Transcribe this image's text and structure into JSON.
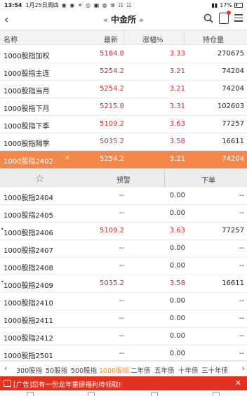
{
  "status_bar": {
    "time": "13:54",
    "date": "1月25日周四",
    "battery": "17%"
  },
  "nav": {
    "title": "中金所"
  },
  "columns": {
    "name": "名称",
    "price": "最新",
    "change_pct": "涨幅%",
    "open_interest": "持仓量"
  },
  "rows": [
    {
      "name": "1000股指加权",
      "price": "5184.8",
      "pct": "3.33",
      "oi": "270675"
    },
    {
      "name": "1000股指主连",
      "price": "5254.2",
      "pct": "3.21",
      "oi": "74204"
    },
    {
      "name": "1000股指当月",
      "price": "5254.2",
      "pct": "3.21",
      "oi": "74204"
    },
    {
      "name": "1000股指下月",
      "price": "5215.8",
      "pct": "3.31",
      "oi": "102603"
    },
    {
      "name": "1000股指下季",
      "price": "5109.2",
      "pct": "3.63",
      "oi": "77257"
    },
    {
      "name": "1000股指隔季",
      "price": "5035.2",
      "pct": "3.58",
      "oi": "16611"
    },
    {
      "name": "1000股指2402",
      "price": "5254.2",
      "pct": "3.21",
      "oi": "74204",
      "close": "×"
    }
  ],
  "actions": {
    "trade": "预警",
    "order": "下单"
  },
  "contract_rows": [
    {
      "name": "1000股指2404",
      "price": "--",
      "pct": "0.00",
      "oi": "--",
      "flag": ""
    },
    {
      "name": "1000股指2405",
      "price": "--",
      "pct": "0.00",
      "oi": "--",
      "flag": ""
    },
    {
      "name": "1000股指2406",
      "price": "5109.2",
      "pct": "3.63",
      "oi": "77257",
      "flag": "•"
    },
    {
      "name": "1000股指2407",
      "price": "--",
      "pct": "0.00",
      "oi": "--",
      "flag": ""
    },
    {
      "name": "1000股指2408",
      "price": "--",
      "pct": "0.00",
      "oi": "--",
      "flag": ""
    },
    {
      "name": "1000股指2409",
      "price": "5035.2",
      "pct": "3.58",
      "oi": "16611",
      "flag": "•"
    },
    {
      "name": "1000股指2410",
      "price": "--",
      "pct": "0.00",
      "oi": "--",
      "flag": ""
    },
    {
      "name": "1000股指2411",
      "price": "--",
      "pct": "0.00",
      "oi": "--",
      "flag": ""
    },
    {
      "name": "1000股指2412",
      "price": "--",
      "pct": "0.00",
      "oi": "--",
      "flag": ""
    },
    {
      "name": "1000股指2501",
      "price": "--",
      "pct": "0.00",
      "oi": "--",
      "flag": ""
    }
  ],
  "tabs": [
    {
      "label": "300股指"
    },
    {
      "label": "50股指"
    },
    {
      "label": "500股指"
    },
    {
      "label": "1000股指",
      "active": true
    },
    {
      "label": "二年债"
    },
    {
      "label": "五年债"
    },
    {
      "label": "十年债"
    },
    {
      "label": "三十年债"
    }
  ],
  "banner": {
    "text": "[广告]您有一份龙年重磅福利待领取!",
    "close": "✕"
  },
  "colors": {
    "up": "#c8302c",
    "selected_row": "#f6874a",
    "active_tab": "#f08a2a",
    "banner": "#e3301f"
  }
}
